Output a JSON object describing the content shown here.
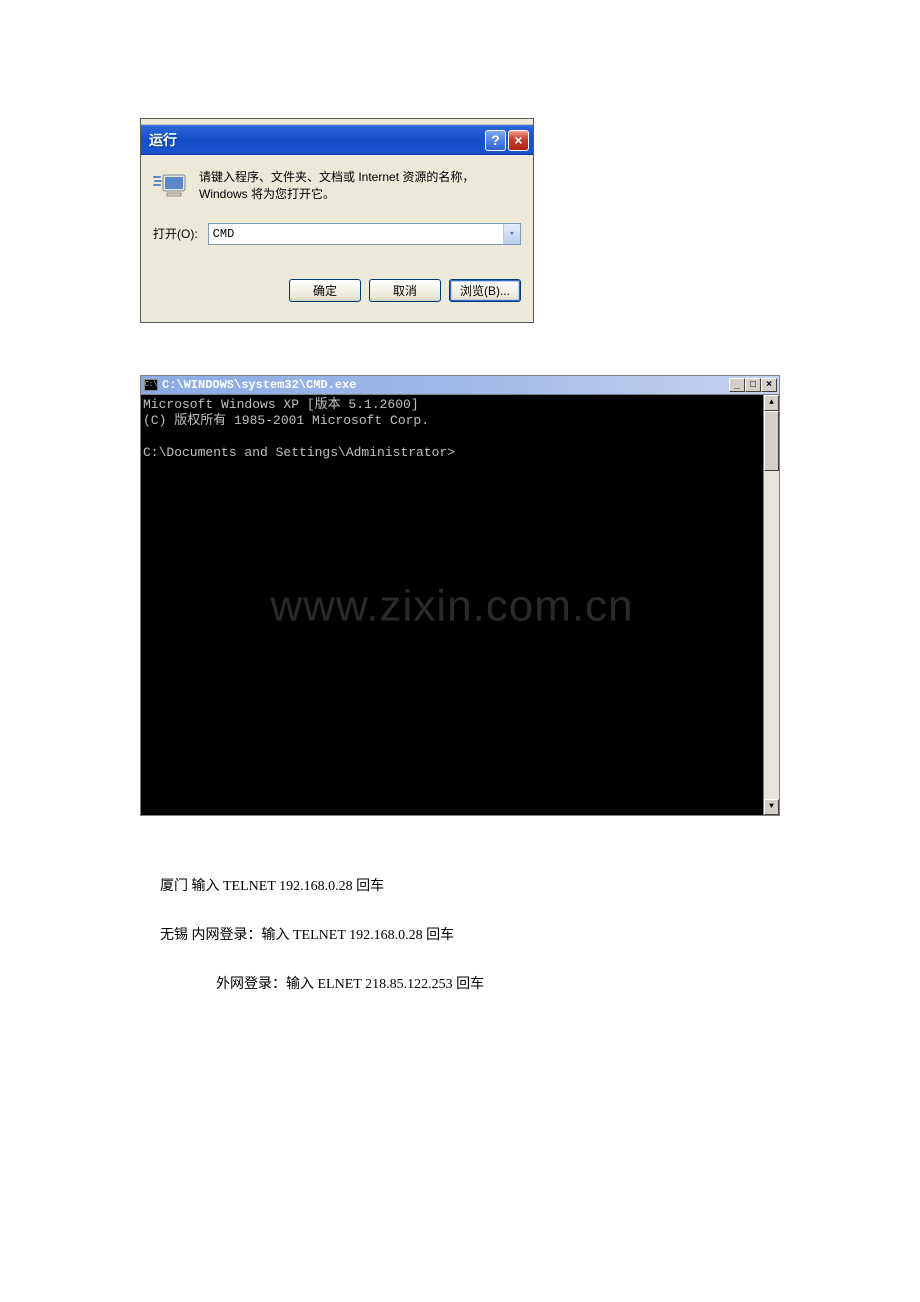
{
  "run_dialog": {
    "title": "运行",
    "description": "请键入程序、文件夹、文档或 Internet 资源的名称，Windows 将为您打开它。",
    "open_label": "打开(O):",
    "input_value": "CMD",
    "buttons": {
      "ok": "确定",
      "cancel": "取消",
      "browse": "浏览(B)..."
    }
  },
  "cmd_window": {
    "icon_text": "C:\\",
    "title": "C:\\WINDOWS\\system32\\CMD.exe",
    "line1": "Microsoft Windows XP [版本 5.1.2600]",
    "line2": "(C) 版权所有 1985-2001 Microsoft Corp.",
    "prompt": "C:\\Documents and Settings\\Administrator>",
    "watermark": "www.zixin.com.cn"
  },
  "instructions": {
    "line1": "厦门   输入 TELNET 192.168.0.28   回车",
    "line2": "无锡   内网登录：输入 TELNET   192.168.0.28 回车",
    "line3": "外网登录：输入 ELNET 218.85.122.253 回车"
  },
  "glyphs": {
    "dropdown_arrow": "▾",
    "scroll_up": "▲",
    "scroll_down": "▼",
    "minimize": "_",
    "maximize": "□",
    "close": "×",
    "help": "?"
  }
}
